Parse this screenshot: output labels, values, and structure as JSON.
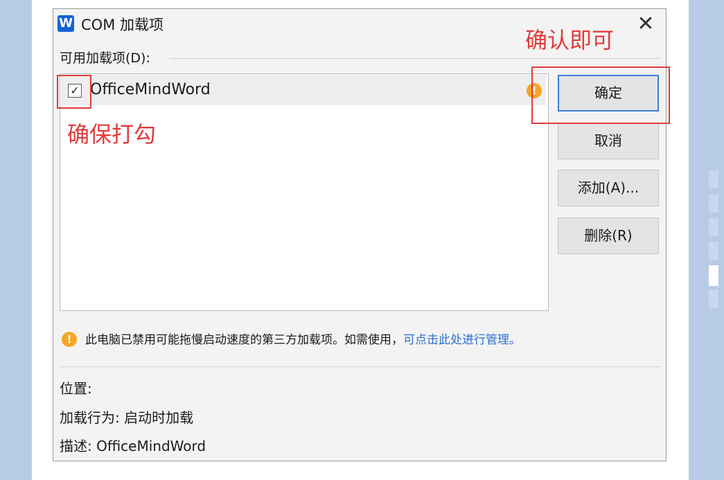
{
  "dialog": {
    "app_icon_letter": "W",
    "title": "COM 加载项",
    "close_glyph": "✕",
    "available_label": "可用加载项(D):",
    "addins": [
      {
        "name": "OfficeMindWord",
        "checked": true,
        "check_glyph": "✓"
      }
    ],
    "buttons": {
      "ok": "确定",
      "cancel": "取消",
      "add": "添加(A)...",
      "remove": "删除(R)"
    },
    "warning_glyph": "!",
    "notice": {
      "text": "此电脑已禁用可能拖慢启动速度的第三方加载项。如需使用，",
      "link": "可点击此处进行管理。"
    },
    "info": {
      "location": "位置:",
      "load_behavior": "加载行为: 启动时加载",
      "description": "描述: OfficeMindWord"
    }
  },
  "annotations": {
    "confirm_note": "确认即可",
    "check_note": "确保打勾"
  },
  "colors": {
    "accent_blue": "#3b7ed6",
    "warning_orange": "#f5a623",
    "annotation_red": "#e23b3b",
    "link_blue": "#2b6fd1"
  },
  "icons": {
    "app": "wps-writer-icon",
    "close": "close-icon",
    "warning": "warning-icon",
    "check": "checkmark-icon"
  }
}
